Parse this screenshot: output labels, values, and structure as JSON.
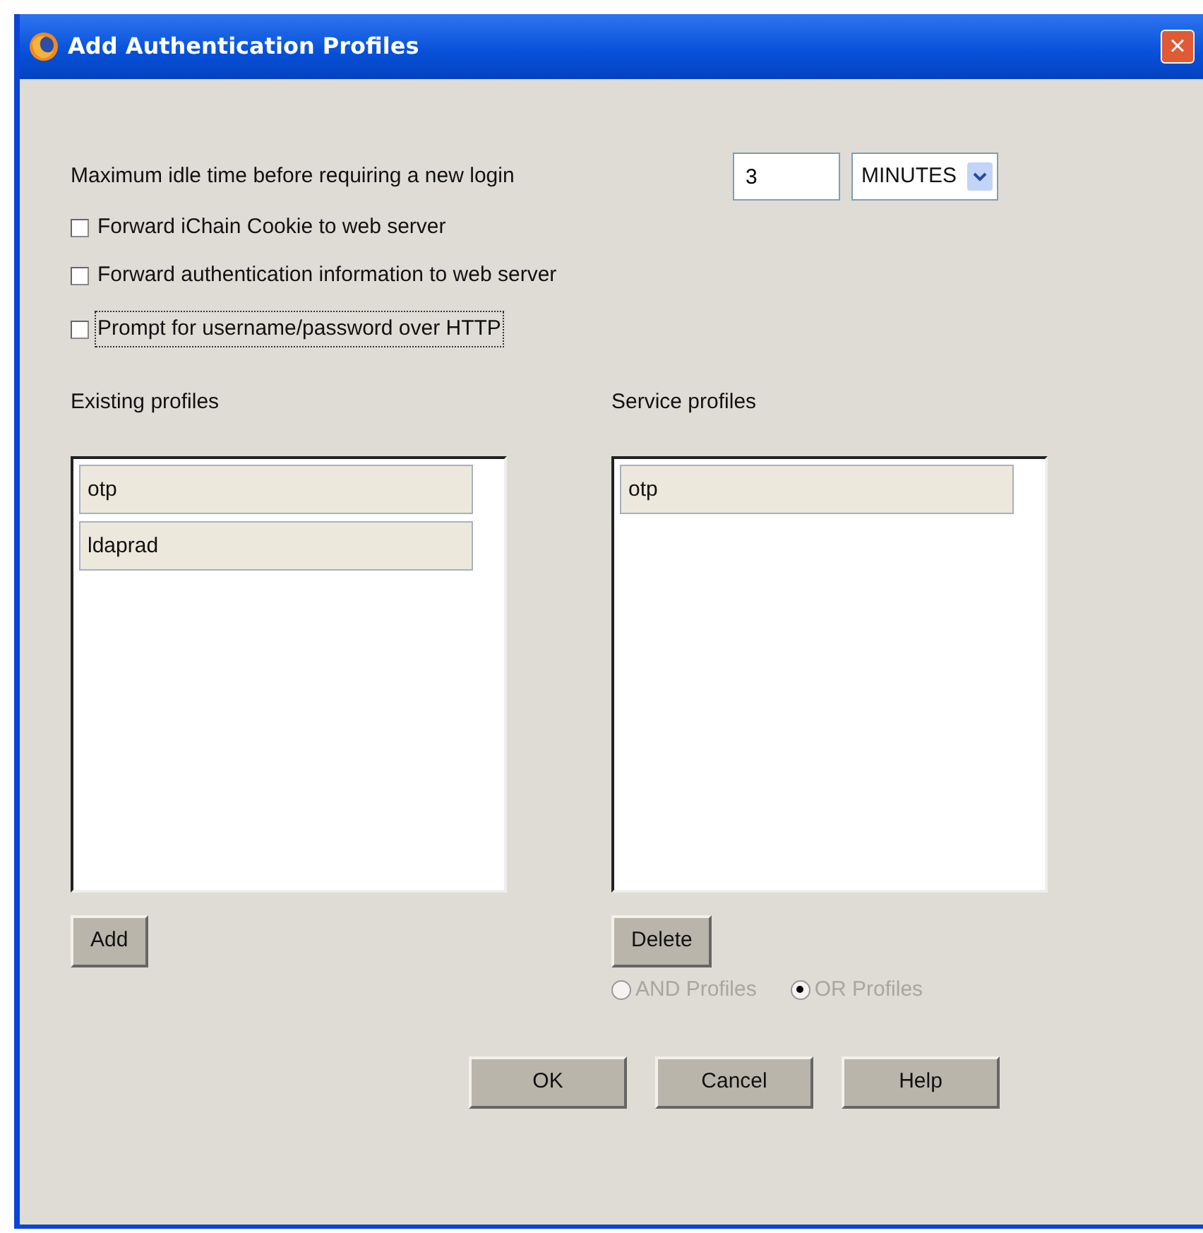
{
  "window": {
    "title": "Add Authentication Profiles",
    "close": "×"
  },
  "idle": {
    "label": "Maximum idle time before requiring a new login",
    "value": "3",
    "unit": "MINUTES"
  },
  "options": [
    {
      "label": "Forward iChain Cookie to web server",
      "checked": false,
      "focused": false
    },
    {
      "label": "Forward authentication information to web server",
      "checked": false,
      "focused": false
    },
    {
      "label": "Prompt for username/password over HTTP",
      "checked": false,
      "focused": true
    }
  ],
  "existing": {
    "title": "Existing profiles",
    "items": [
      "otp",
      "ldaprad"
    ],
    "button": "Add"
  },
  "service": {
    "title": "Service profiles",
    "items": [
      "otp"
    ],
    "button": "Delete"
  },
  "logic": [
    {
      "label": "AND Profiles",
      "selected": false,
      "disabled": true
    },
    {
      "label": "OR Profiles",
      "selected": true,
      "disabled": true
    }
  ],
  "buttons": [
    "OK",
    "Cancel",
    "Help"
  ]
}
